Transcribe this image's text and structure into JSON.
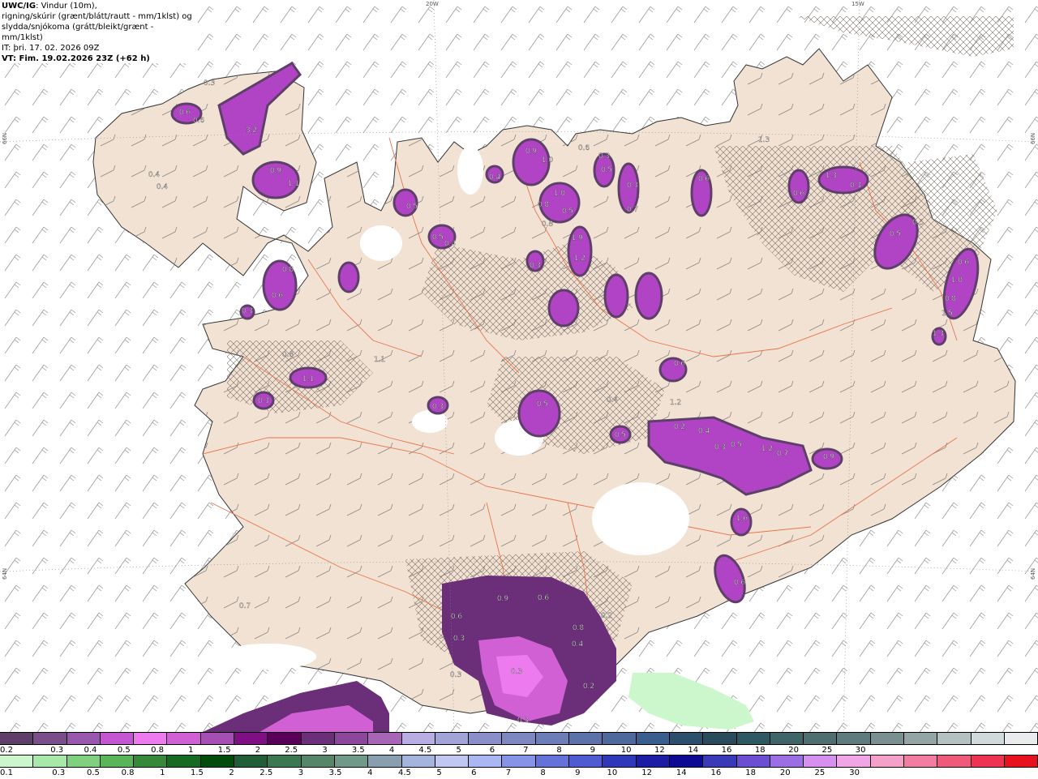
{
  "header": {
    "model": "UWC/IG",
    "line1": ": Vindur (10m),",
    "line2": "rigning/skúrir (grænt/blátt/rautt - mm/1klst) og",
    "line3": "slydda/snjókoma (grátt/bleikt/grænt - mm/1klst)",
    "init_time": "IT: þri. 17. 02. 2026 09Z",
    "valid_time": "VT: Fim. 19.02.2026 23Z (+62 h)"
  },
  "graticule": {
    "lon_labels": [
      "20W",
      "15W"
    ],
    "lat_labels": [
      "66N",
      "66N",
      "64N",
      "64N"
    ]
  },
  "precip_labels": [
    "0.3",
    "0.6",
    "0.6",
    "3.2",
    "0.9",
    "1.1",
    "0.4",
    "0.4",
    "0.5",
    "0.5",
    "0.4",
    "0.4",
    "0.9",
    "1.0",
    "0.8",
    "0.8",
    "0.5",
    "1.0",
    "0.3",
    "0.6",
    "1.9",
    "1.2",
    "0.3",
    "0.5",
    "0.3",
    "0.7",
    "0.6",
    "1.3",
    "0.6",
    "1.3",
    "0.3",
    "0.5",
    "0.5",
    "0.6",
    "1.0",
    "0.8",
    "1.5",
    "1.3",
    "0.8",
    "0.6",
    "0.3",
    "1.1",
    "0.8",
    "0.3",
    "1.1",
    "0.3",
    "0.5",
    "0.4",
    "1.2",
    "0.5",
    "0.6",
    "0.2",
    "0.4",
    "0.3",
    "0.5",
    "1.2",
    "0.7",
    "0.9",
    "1.6",
    "0.6",
    "0.7",
    "0.9",
    "0.6",
    "0.6",
    "0.3",
    "0.8",
    "0.2",
    "0.4",
    "0.3",
    "0.2",
    "0.3",
    "0.3",
    "0.3",
    "0.3",
    "0.4",
    "1.7",
    "0.4",
    "0.6"
  ],
  "legend_snow": {
    "colors": [
      "#5e3f69",
      "#7a4e8a",
      "#9a57ae",
      "#c257d1",
      "#ee7af0",
      "#d060d4",
      "#a64fb2",
      "#800f86",
      "#5a0058",
      "#6b2e78",
      "#8a479b",
      "#a766b5",
      "#b9aee3",
      "#a2a3d7",
      "#8b8fc9",
      "#7d87c0",
      "#6c7db8",
      "#5c72a8",
      "#4e6a9d",
      "#3a5e8d",
      "#2d4f6e",
      "#2a4b5c",
      "#2f5962",
      "#3f6569",
      "#4e6e70",
      "#5f7b7d",
      "#7a8f8f",
      "#94a5a5",
      "#b3c1c1",
      "#d0dada",
      "#e8ecec"
    ],
    "labels": [
      "0.2",
      "0.3",
      "0.4",
      "0.5",
      "0.8",
      "1",
      "1.5",
      "2",
      "2.5",
      "3",
      "3.5",
      "4",
      "4.5",
      "5",
      "6",
      "7",
      "8",
      "9",
      "10",
      "12",
      "14",
      "16",
      "18",
      "20",
      "25",
      "30"
    ]
  },
  "legend_rain": {
    "colors": [
      "#ccf7cc",
      "#a8e8a8",
      "#7fd17f",
      "#59b45a",
      "#37893a",
      "#166a21",
      "#004c0a",
      "#1f5e37",
      "#3b7750",
      "#56866a",
      "#6f9a8a",
      "#889fb0",
      "#a3b5dc",
      "#c0c8f2",
      "#a9b7f2",
      "#8594e6",
      "#6572d9",
      "#4f5bd0",
      "#2f38b9",
      "#1b1da4",
      "#0b0a93",
      "#3a3ab8",
      "#6b4fd2",
      "#9b6ee3",
      "#d691f0",
      "#f0a6e6",
      "#f5a0c8",
      "#f27ca2",
      "#ef5a7a",
      "#ee3352",
      "#e8121f"
    ],
    "labels": [
      "0.1",
      "0.3",
      "0.5",
      "0.8",
      "1",
      "1.5",
      "2",
      "2.5",
      "3",
      "3.5",
      "4",
      "4.5",
      "5",
      "6",
      "7",
      "8",
      "9",
      "10",
      "12",
      "14",
      "16",
      "18",
      "20",
      "25",
      "30"
    ]
  },
  "colors": {
    "land": "#f1e2d4",
    "sea": "#ffffff",
    "glacier": "#ffffff",
    "roads": "#e8744c",
    "wind_barbs": "#7a7a7a",
    "hatch": "#6f6257"
  }
}
